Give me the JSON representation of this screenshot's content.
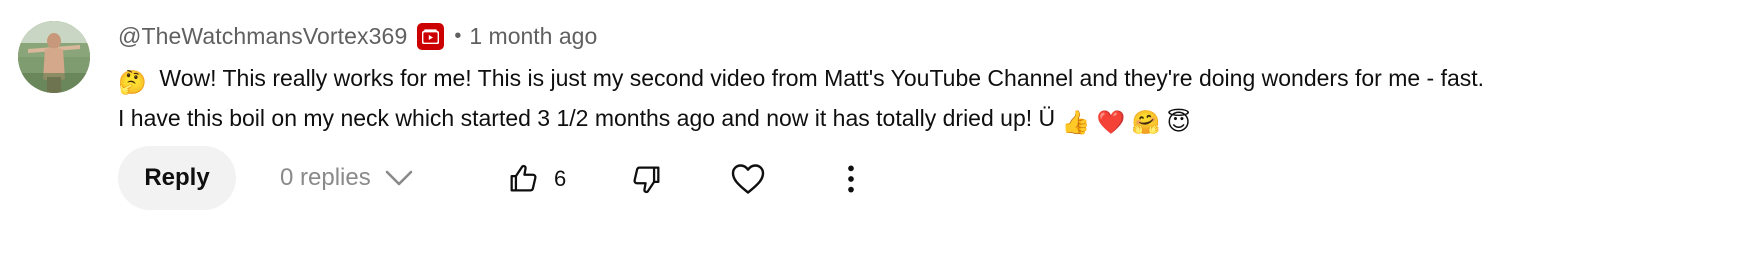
{
  "comment": {
    "author_handle": "@TheWatchmansVortex369",
    "separator": "•",
    "timestamp": "1 month ago",
    "line1_text": "Wow! This really works for me! This is just my second video from Matt's YouTube Channel and they're doing wonders for me - fast.",
    "line2_text": "I have this boil on my neck which started 3 1/2 months ago and now it has totally dried up!  Ü",
    "emojis": {
      "thinking": "🤔",
      "thumbs_up": "👍",
      "heart": "❤️",
      "hug": "🤗",
      "halo": "😇"
    }
  },
  "actions": {
    "reply_label": "Reply",
    "replies_label": "0 replies",
    "like_count": "6"
  },
  "colors": {
    "badge_red": "#cc0000",
    "muted_text": "#606060",
    "reply_bg": "#f2f2f2"
  },
  "icons": [
    "avatar",
    "youtube-member-badge-icon",
    "chevron-down-icon",
    "thumbs-up-icon",
    "thumbs-down-icon",
    "heart-icon",
    "more-vert-icon"
  ]
}
